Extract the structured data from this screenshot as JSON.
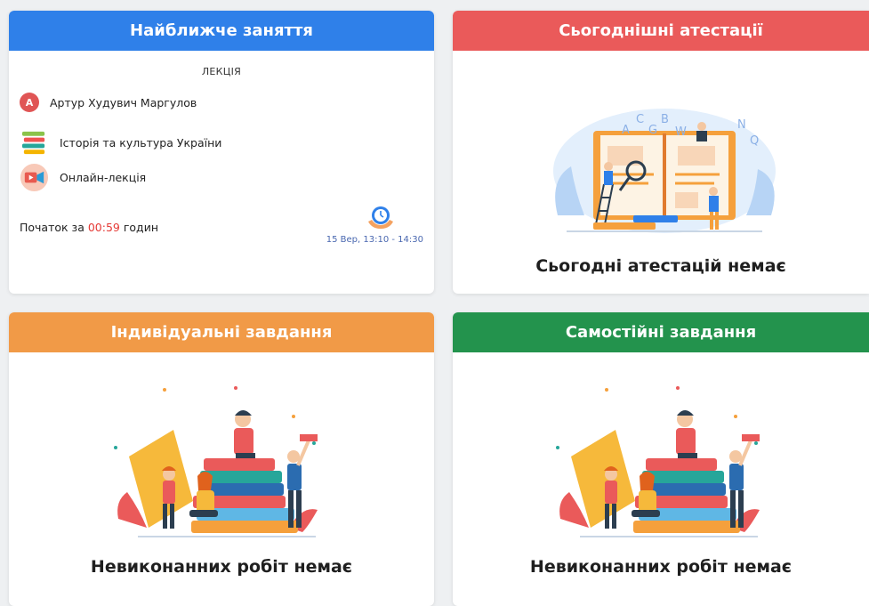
{
  "lesson_card": {
    "title": "Найближче заняття",
    "header_color": "#2f80e9",
    "type": "ЛЕКЦІЯ",
    "teacher_initial": "А",
    "teacher": "Артур Худувич Маргулов",
    "subject": "Історія та культура України",
    "format": "Онлайн-лекція",
    "start_prefix": "Початок за ",
    "start_timer": "00:59",
    "start_suffix": " годин",
    "date_time": "15 Вер, 13:10 - 14:30",
    "icons": [
      "books-icon",
      "video-call-icon",
      "clock-icon"
    ]
  },
  "attestation_card": {
    "title": "Сьогоднішні атестації",
    "header_color": "#ea5a5a",
    "empty_text": "Сьогодні атестацій немає",
    "illustration": "open-book-illustration"
  },
  "individual_card": {
    "title": "Індивідуальні завдання",
    "header_color": "#f19a47",
    "empty_text": "Невиконанних робіт немає",
    "illustration": "students-books-illustration"
  },
  "self_card": {
    "title": "Самостійні завдання",
    "header_color": "#23934d",
    "empty_text": "Невиконанних робіт немає",
    "illustration": "students-books-illustration"
  }
}
